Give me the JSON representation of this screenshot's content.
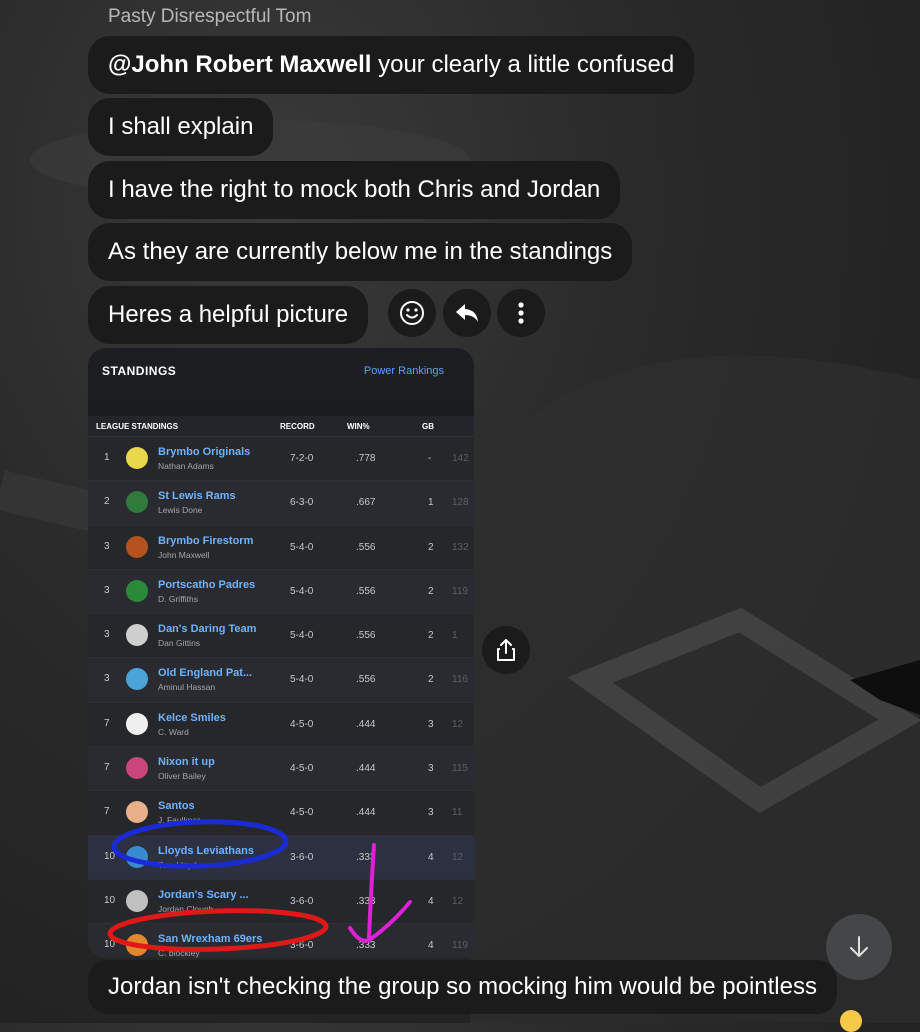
{
  "chat": {
    "sender": "Pasty Disrespectful Tom",
    "messages": [
      {
        "mention": "@John Robert Maxwell",
        "text": " your clearly a little confused"
      },
      {
        "text": "I shall explain"
      },
      {
        "text": "I have the right to mock both Chris and Jordan"
      },
      {
        "text": "As they are currently below me in the standings"
      },
      {
        "text": "Heres a helpful picture"
      }
    ],
    "last_message": "Jordan isn't checking the group so mocking him would be pointless"
  },
  "actions": {
    "react_icon": "smiley-icon",
    "reply_icon": "reply-icon",
    "more_icon": "more-vertical-icon",
    "share_icon": "share-icon",
    "scroll_icon": "arrow-down-icon"
  },
  "standings": {
    "title": "STANDINGS",
    "link": "Power Rankings",
    "columns": [
      "LEAGUE STANDINGS",
      "RECORD",
      "WIN%",
      "GB"
    ],
    "rows": [
      {
        "rank": "1",
        "team": "Brymbo Originals",
        "owner": "Nathan Adams",
        "record": "7-2-0",
        "win": ".778",
        "gb": "-",
        "pts": "142"
      },
      {
        "rank": "2",
        "team": "St Lewis Rams",
        "owner": "Lewis Done",
        "record": "6-3-0",
        "win": ".667",
        "gb": "1",
        "pts": "128"
      },
      {
        "rank": "3",
        "team": "Brymbo Firestorm",
        "owner": "John Maxwell",
        "record": "5-4-0",
        "win": ".556",
        "gb": "2",
        "pts": "132"
      },
      {
        "rank": "3",
        "team": "Portscatho Padres",
        "owner": "D. Griffiths",
        "record": "5-4-0",
        "win": ".556",
        "gb": "2",
        "pts": "119"
      },
      {
        "rank": "3",
        "team": "Dan's Daring Team",
        "owner": "Dan Gittins",
        "record": "5-4-0",
        "win": ".556",
        "gb": "2",
        "pts": "1"
      },
      {
        "rank": "3",
        "team": "Old England Pat...",
        "owner": "Aminul Hassan",
        "record": "5-4-0",
        "win": ".556",
        "gb": "2",
        "pts": "116"
      },
      {
        "rank": "7",
        "team": "Kelce Smiles",
        "owner": "C. Ward",
        "record": "4-5-0",
        "win": ".444",
        "gb": "3",
        "pts": "12"
      },
      {
        "rank": "7",
        "team": "Nixon it up",
        "owner": "Oliver Bailey",
        "record": "4-5-0",
        "win": ".444",
        "gb": "3",
        "pts": "115"
      },
      {
        "rank": "7",
        "team": "Santos",
        "owner": "J. Faulkner",
        "record": "4-5-0",
        "win": ".444",
        "gb": "3",
        "pts": "11"
      },
      {
        "rank": "10",
        "team": "Lloyds Leviathans",
        "owner": "Tom Lloyd",
        "record": "3-6-0",
        "win": ".333",
        "gb": "4",
        "pts": "12"
      },
      {
        "rank": "10",
        "team": "Jordan's Scary ...",
        "owner": "Jordan Clough",
        "record": "3-6-0",
        "win": ".333",
        "gb": "4",
        "pts": "12"
      },
      {
        "rank": "10",
        "team": "San Wrexham 69ers",
        "owner": "C. blockley",
        "record": "3-6-0",
        "win": ".333",
        "gb": "4",
        "pts": "119"
      }
    ],
    "logo_colors": [
      "#e8d84a",
      "#2f7a3c",
      "#b5521f",
      "#2a8a3a",
      "#cfcfcf",
      "#4aa4d8",
      "#f0f0f0",
      "#c9467a",
      "#e8b08a",
      "#3a8ad0",
      "#c0c0c0",
      "#e2882a"
    ]
  },
  "annotations": {
    "blue": "#1a2bd6",
    "red": "#e01818",
    "magenta": "#e020d8"
  }
}
